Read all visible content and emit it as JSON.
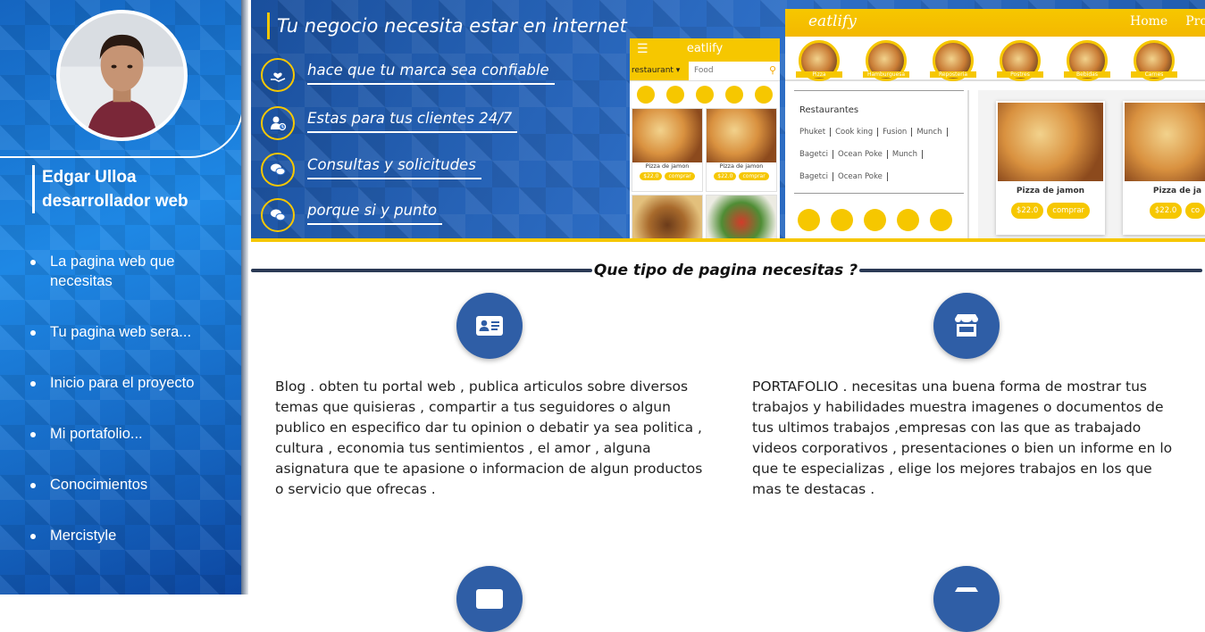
{
  "sidebar": {
    "name_line1": "Edgar Ulloa",
    "name_line2": "desarrollador web",
    "items": [
      {
        "label": "La pagina web que necesitas"
      },
      {
        "label": "Tu pagina web sera..."
      },
      {
        "label": "Inicio para el proyecto"
      },
      {
        "label": "Mi portafolio..."
      },
      {
        "label": "Conocimientos"
      },
      {
        "label": "Mercistyle"
      }
    ]
  },
  "hero": {
    "title": "Tu negocio necesita estar en internet",
    "features": [
      {
        "text": "hace que tu marca sea confiable",
        "icon": "heart-hand-icon"
      },
      {
        "text": "Estas para tus clientes 24/7",
        "icon": "user-clock-icon"
      },
      {
        "text": "Consultas y solicitudes",
        "icon": "chat-bubbles-icon"
      },
      {
        "text": "porque si y punto",
        "icon": "chat-bubbles-icon"
      }
    ]
  },
  "phone": {
    "logo": "eatlify",
    "select_value": "restaurant",
    "search_placeholder": "Food",
    "cards": [
      {
        "name": "Pizza de jamon",
        "price": "$22.0",
        "buy": "comprar"
      },
      {
        "name": "Pizza de jamon",
        "price": "$22.0",
        "buy": "comprar"
      }
    ]
  },
  "tablet": {
    "logo": "eatlify",
    "menu": [
      "Home",
      "Prod"
    ],
    "categories": [
      "Pizza",
      "Hamburguesa",
      "Reposteria",
      "Postres",
      "Bebidas",
      "Carnes"
    ],
    "restaurants_heading": "Restaurantes",
    "restaurant_rows": [
      [
        "Phuket",
        "Cook king",
        "Fusion",
        "Munch"
      ],
      [
        "Bagetci",
        "Ocean Poke",
        "Munch"
      ],
      [
        "Bagetci",
        "Ocean Poke"
      ]
    ],
    "cards": [
      {
        "name": "Pizza de jamon",
        "price": "$22.0",
        "buy": "comprar"
      },
      {
        "name": "Pizza de ja",
        "price": "$22.0",
        "buy": "co"
      }
    ]
  },
  "section": {
    "title": "Que tipo de pagina necesitas ?",
    "blog_text": "Blog . obten tu portal web , publica articulos sobre diversos temas que quisieras , compartir a tus seguidores o algun publico en especifico dar tu opinion o debatir ya sea politica , cultura , economia tus sentimientos , el amor , alguna asignatura que te apasione o informacion de algun productos o servicio que ofrecas .",
    "portfolio_text": "PORTAFOLIO . necesitas una buena forma de mostrar tus trabajos y habilidades muestra imagenes o documentos de tus ultimos trabajos ,empresas con las que as trabajado videos corporativos , presentaciones o bien un informe en lo que te especializas , elige los mejores trabajos en los que mas te destacas ."
  },
  "colors": {
    "sidebar_blue": "#1e88e5",
    "accent_yellow": "#f6c700",
    "icon_circle": "#2f5ea6",
    "rule_dark": "#2b3a55"
  }
}
